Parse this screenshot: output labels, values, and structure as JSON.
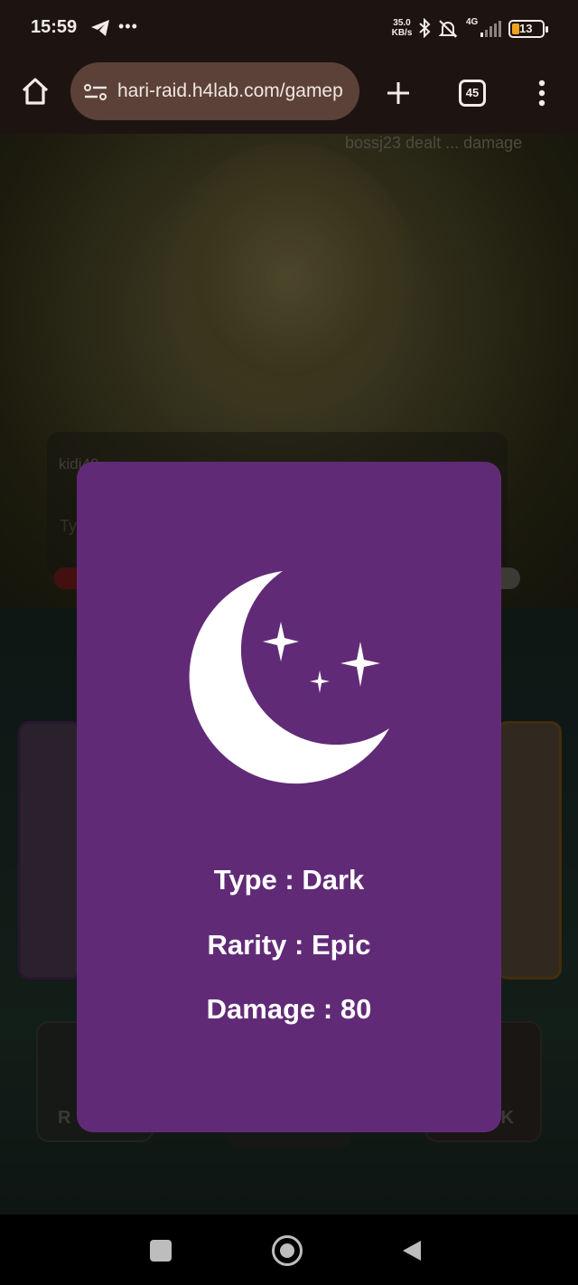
{
  "status_bar": {
    "time": "15:59",
    "more": "•••",
    "net_speed_value": "35.0",
    "net_speed_unit": "KB/s",
    "network_type": "4G",
    "battery_level": "13"
  },
  "browser": {
    "url": "hari-raid.h4lab.com/gamep",
    "tab_count": "45"
  },
  "background": {
    "boss_damage_text": "bossj23 dealt ... damage",
    "chat_user": "kidi40",
    "chat_input_hint": "Ty",
    "hp_fraction": 0.08,
    "left_button_text": "R",
    "right_button_text": "CK"
  },
  "card": {
    "type_line": "Type : Dark",
    "rarity_line": "Rarity : Epic",
    "damage_line": "Damage : 80",
    "icon": "crescent-moon-with-stars-icon",
    "background_color": "#612a77"
  }
}
